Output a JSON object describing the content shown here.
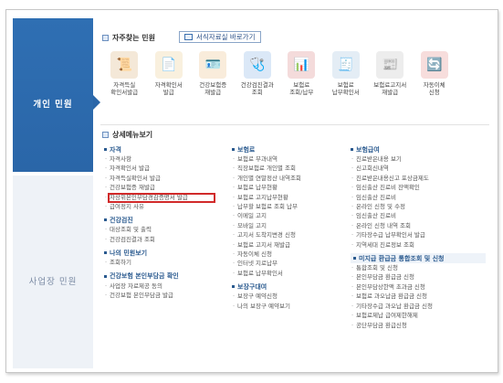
{
  "left_rail": {
    "personal": "개인 민원",
    "business": "사업장 민원"
  },
  "quick": {
    "title": "자주찾는 민원",
    "forms_button": "서식자료실 바로가기",
    "items": [
      {
        "l1": "자격득실",
        "l2": "확인서발급",
        "icon": "certificate-icon",
        "color": "#c98a3b",
        "glyph": "📜"
      },
      {
        "l1": "자격확인서",
        "l2": "발급",
        "icon": "document-icon",
        "color": "#e3b25a",
        "glyph": "📄"
      },
      {
        "l1": "건강보험증",
        "l2": "재발급",
        "icon": "card-icon",
        "color": "#e2a24a",
        "glyph": "🪪"
      },
      {
        "l1": "건강검진결과",
        "l2": "조회",
        "icon": "checkup-icon",
        "color": "#4c8ed9",
        "glyph": "🩺"
      },
      {
        "l1": "보험료",
        "l2": "조회/납부",
        "icon": "chart-icon",
        "color": "#c94b4b",
        "glyph": "📊"
      },
      {
        "l1": "보험료",
        "l2": "납부확인서",
        "icon": "receipt-icon",
        "color": "#7aa6cf",
        "glyph": "🧾"
      },
      {
        "l1": "보험료고지서",
        "l2": "재발급",
        "icon": "notice-icon",
        "color": "#a6a6a6",
        "glyph": "📰"
      },
      {
        "l1": "자동이체",
        "l2": "신청",
        "icon": "transfer-icon",
        "color": "#d9534f",
        "glyph": "🔄"
      }
    ]
  },
  "detail": {
    "title": "상세메뉴보기",
    "col1": [
      {
        "head": "자격",
        "items": [
          "자격사항",
          "자격확인서 발급",
          "자격득실확인서 발급",
          "건강보험증 재발급",
          "자상위본인부담경감증명서 발급",
          "급여정지 사유"
        ]
      },
      {
        "head": "건강검진",
        "items": [
          "대상조회 및 출력",
          "건강검진결과 조회"
        ]
      },
      {
        "head": "나의 민원보기",
        "items": [
          "조회하기"
        ]
      },
      {
        "head": "건강보험 본인부담금 확인",
        "items": [
          "사업장 자료제공 동의",
          "건강보험 본인부담금 발급"
        ]
      }
    ],
    "col2": [
      {
        "head": "보험료",
        "items": [
          "보험료 부과내역",
          "직장보험료 개인별 조회",
          "개인별 연말정산 내역조회",
          "보험료 납부현황",
          "보험료 고지납부현황",
          "납부할 보험료 조회 납부",
          "이메일 고지",
          "모바일 고지",
          "고지서 도착지변경 신청",
          "보험료 고지서 재발급",
          "자동이체 신청",
          "인터넷 지로납부",
          "보험료 납부확인서"
        ]
      },
      {
        "head": "보장구대여",
        "items": [
          "보장구 예약신청",
          "나의 보장구 예약보기"
        ]
      }
    ],
    "col3": [
      {
        "head": "보험급여",
        "items": [
          "진료받은내용 보기",
          "신고회신내역",
          "진료받은내용신고 포상금제도",
          "임신출산 진료비 잔액확인",
          "임신출산 진료비",
          "온라인 신청 및 수정",
          "임신출산 진료비",
          "온라인 신청 내역 조회",
          "기타장수급 납부확인서 발급",
          "지역세대 진료정보 조회"
        ]
      },
      {
        "head": "미지급 환급금 통합조회 및 신청",
        "items": [
          "통합조회 및 신청",
          "본인부담금 환급금 신청",
          "본인부담상한액 초과금 신청",
          "보험료 과오납금 환급금 신청",
          "기타장수급 과오납 환급금 신청",
          "보험료제납 급여제한해제",
          "공단부담금 환급신청"
        ]
      }
    ]
  }
}
